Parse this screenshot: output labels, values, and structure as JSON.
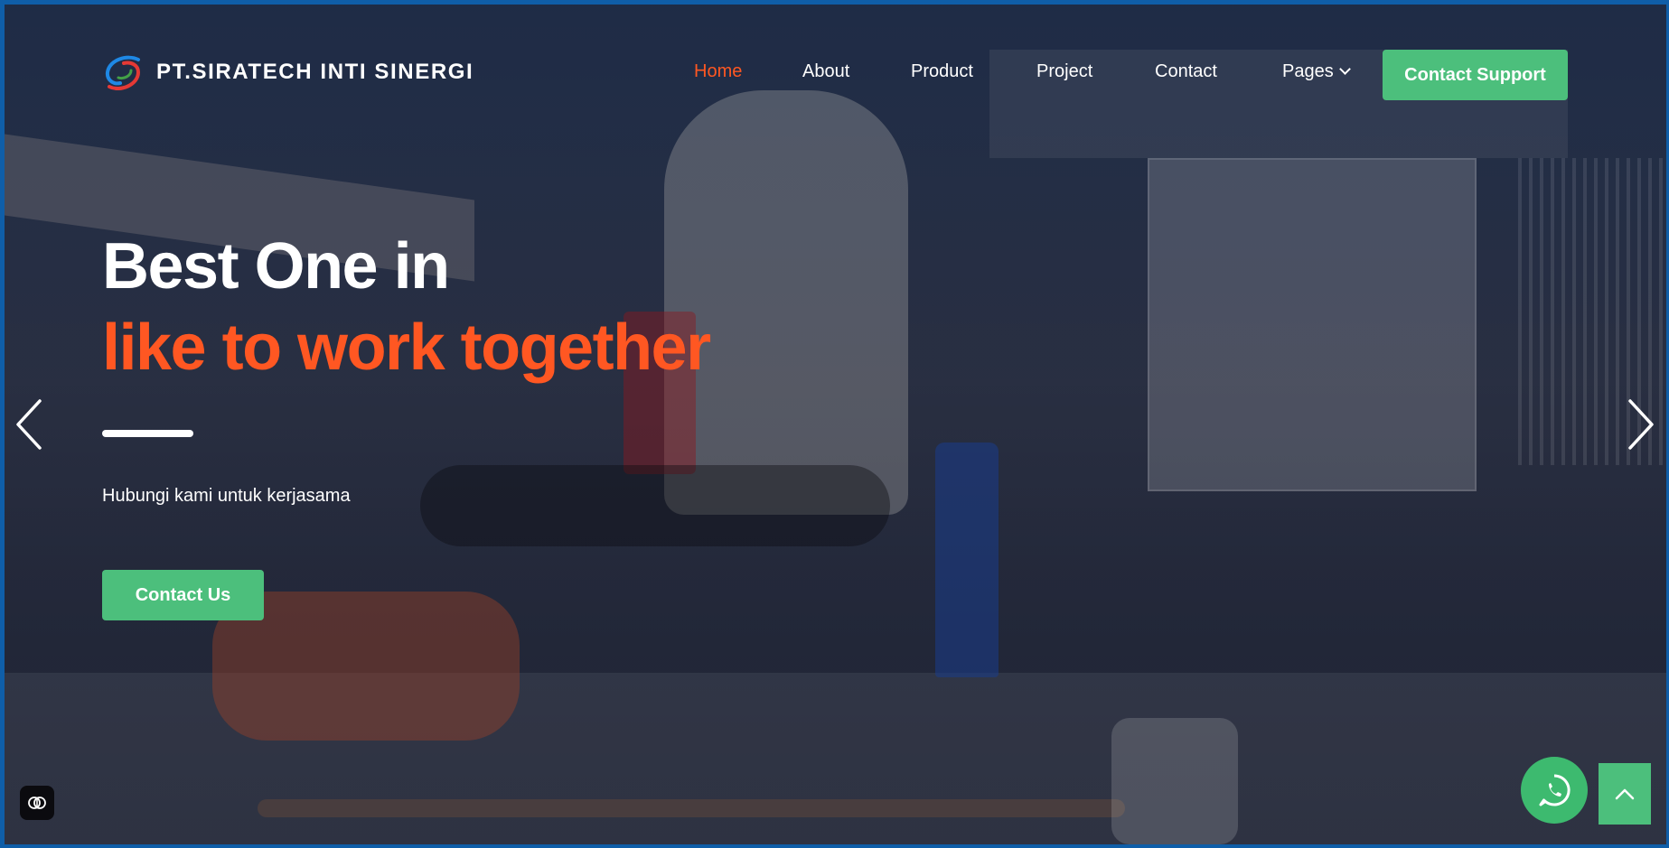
{
  "header": {
    "brand": "PT.SIRATECH INTI SINERGI",
    "logo_icon": "swirl-logo-icon",
    "nav": [
      {
        "label": "Home",
        "active": true
      },
      {
        "label": "About",
        "active": false
      },
      {
        "label": "Product",
        "active": false
      },
      {
        "label": "Project",
        "active": false
      },
      {
        "label": "Contact",
        "active": false
      },
      {
        "label": "Pages",
        "active": false
      }
    ],
    "support_button": "Contact Support"
  },
  "hero": {
    "title_line1": "Best One in",
    "title_line2": "like to work together",
    "subtitle": "Hubungi kami untuk kerjasama",
    "cta_button": "Contact Us"
  },
  "carousel": {
    "prev_icon": "chevron-left-icon",
    "next_icon": "chevron-right-icon"
  },
  "floating": {
    "whatsapp_icon": "whatsapp-icon",
    "back_to_top_icon": "chevron-up-icon",
    "accessibility_icon": "brain-icon"
  },
  "colors": {
    "accent_orange": "#ff5722",
    "button_green": "#4cbf7c",
    "whatsapp_green": "#3dba6f",
    "frame_blue": "#0f5ea8"
  }
}
